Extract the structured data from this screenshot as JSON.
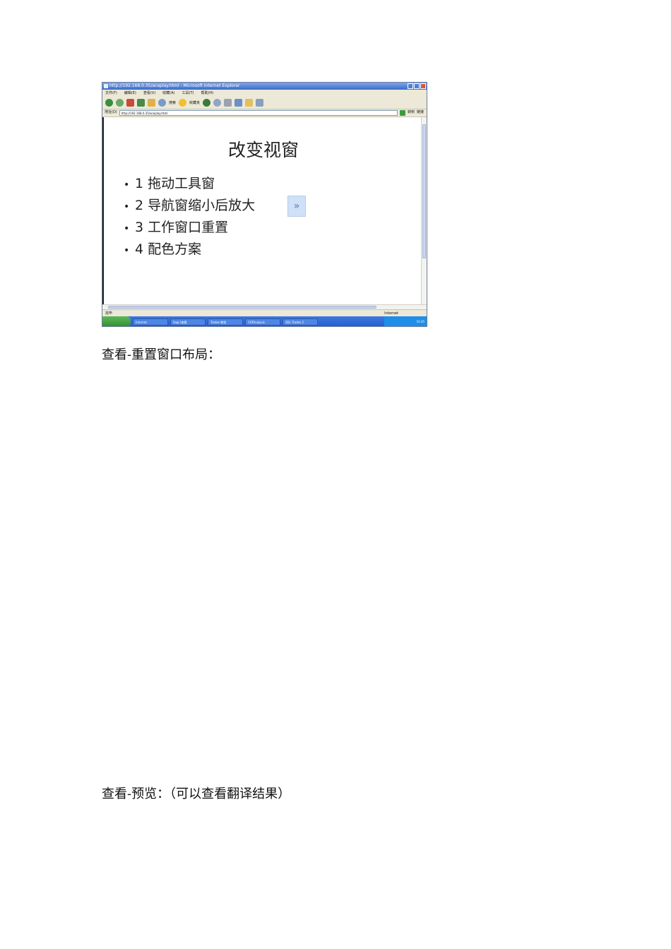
{
  "screenshot": {
    "title_bar": "http://192.168.0.35/aceplay.html - Microsoft Internet Explorer",
    "menu": [
      "文件(F)",
      "编辑(E)",
      "查看(V)",
      "收藏(A)",
      "工具(T)",
      "帮助(H)"
    ],
    "toolbar": {
      "search_label": "搜索",
      "favorites_label": "收藏夹"
    },
    "address": {
      "label": "地址(D)",
      "url": "http://192.168.0.35/aceplay.html",
      "go_label": "转到",
      "links_label": "链接"
    },
    "status": {
      "left": "完毕",
      "zone": "Internet"
    },
    "taskbar": {
      "start_label": "开始",
      "tasks": [
        "Internet",
        "Sagi (查看",
        "Trados 教程",
        "CATAnalysis",
        "SDL Trados 2"
      ],
      "clock": "10:45"
    },
    "slide": {
      "title": "改变视窗",
      "bullets": [
        {
          "num": "1",
          "text": "拖动工具窗"
        },
        {
          "num": "2",
          "text": "导航窗缩小后放大"
        },
        {
          "num": "3",
          "text": "工作窗口重置"
        },
        {
          "num": "4",
          "text": "配色方案"
        }
      ],
      "nav_symbol": "»"
    }
  },
  "captions": {
    "reset_layout": "查看-重置窗口布局：",
    "preview": "查看-预览：（可以查看翻译结果）"
  }
}
